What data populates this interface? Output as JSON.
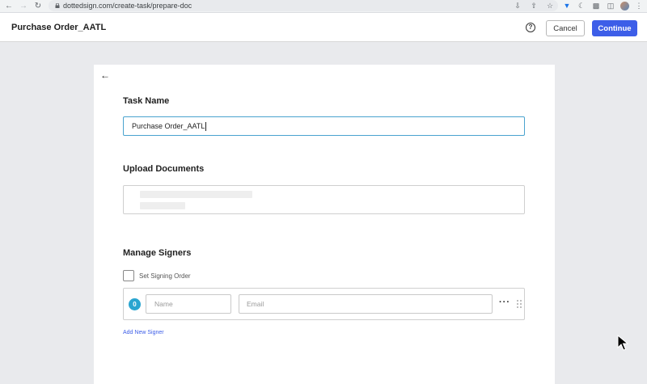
{
  "browser": {
    "url": "dottedsign.com/create-task/prepare-doc"
  },
  "header": {
    "title": "Purchase Order_AATL",
    "help_icon": "question-circle-icon",
    "cancel_label": "Cancel",
    "continue_label": "Continue",
    "accent_color": "#3d5ee8"
  },
  "task": {
    "section_title": "Task Name",
    "value": "Purchase Order_AATL"
  },
  "upload": {
    "section_title": "Upload Documents"
  },
  "signers": {
    "section_title": "Manage Signers",
    "order_label": "Set Signing Order",
    "order_checked": false,
    "rows": [
      {
        "badge": "0",
        "name_placeholder": "Name",
        "email_placeholder": "Email"
      }
    ],
    "add_label": "Add New Signer"
  }
}
